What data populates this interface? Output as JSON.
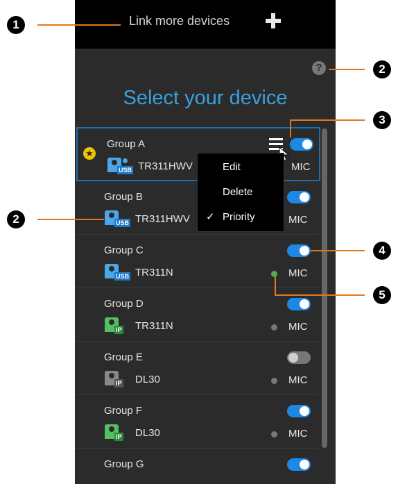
{
  "header": {
    "link_more": "Link more devices"
  },
  "title": "Select your device",
  "groups": [
    {
      "name": "Group A",
      "device": "TR311HWV",
      "mic": "MIC",
      "toggle_on": true,
      "conn": "USB"
    },
    {
      "name": "Group B",
      "device": "TR311HWV",
      "mic": "MIC",
      "toggle_on": true,
      "conn": "USB"
    },
    {
      "name": "Group C",
      "device": "TR311N",
      "mic": "MIC",
      "toggle_on": true,
      "conn": "USB"
    },
    {
      "name": "Group D",
      "device": "TR311N",
      "mic": "MIC",
      "toggle_on": true,
      "conn": "IP"
    },
    {
      "name": "Group E",
      "device": "DL30",
      "mic": "MIC",
      "toggle_on": false,
      "conn": "IP"
    },
    {
      "name": "Group F",
      "device": "DL30",
      "mic": "MIC",
      "toggle_on": true,
      "conn": "IP"
    },
    {
      "name": "Group G",
      "toggle_on": true
    }
  ],
  "context_menu": {
    "items": [
      "Edit",
      "Delete",
      "Priority"
    ],
    "checked": "Priority"
  },
  "callouts": [
    "1",
    "2",
    "3",
    "4",
    "5",
    "2"
  ],
  "colors": {
    "accent": "#1e88e5",
    "title": "#3aa0e0",
    "callout_line": "#e07820",
    "mic_active": "#4caf50"
  }
}
